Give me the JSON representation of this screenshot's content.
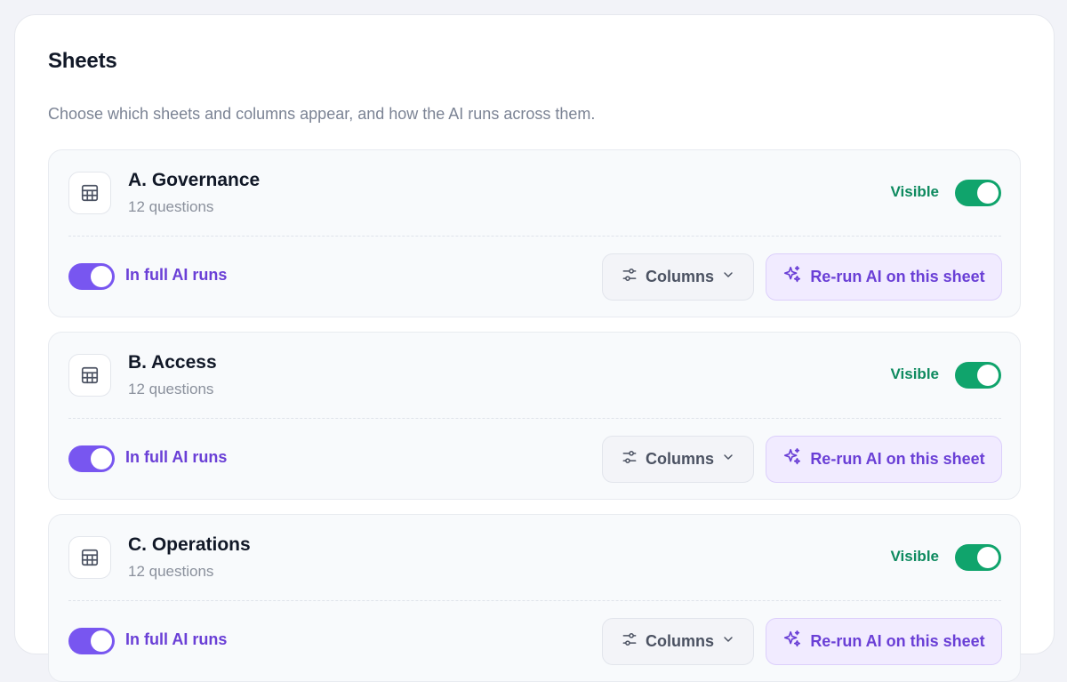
{
  "panel": {
    "title": "Sheets",
    "description": "Choose which sheets and columns appear, and how the AI runs across them."
  },
  "sheets": [
    {
      "name": "A. Governance",
      "count": "12 questions",
      "visible_label": "Visible",
      "visible_on": true,
      "ai_label": "In full AI runs",
      "ai_on": true,
      "columns_label": "Columns",
      "rerun_label": "Re-run AI on this sheet"
    },
    {
      "name": "B. Access",
      "count": "12 questions",
      "visible_label": "Visible",
      "visible_on": true,
      "ai_label": "In full AI runs",
      "ai_on": true,
      "columns_label": "Columns",
      "rerun_label": "Re-run AI on this sheet"
    },
    {
      "name": "C. Operations",
      "count": "12 questions",
      "visible_label": "Visible",
      "visible_on": true,
      "ai_label": "In full AI runs",
      "ai_on": true,
      "columns_label": "Columns",
      "rerun_label": "Re-run AI on this sheet"
    }
  ],
  "icons": {
    "sheet": "table-icon",
    "columns": "sliders-icon",
    "dropdown": "chevron-down-icon",
    "rerun": "sparkles-icon"
  },
  "colors": {
    "visible_green": "#10a46c",
    "ai_purple": "#7856f0",
    "accent_text_purple": "#6a3fd6"
  }
}
